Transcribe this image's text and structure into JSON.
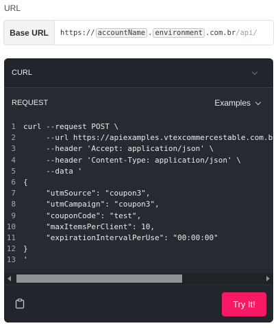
{
  "url_section": {
    "label": "URL",
    "base_url_label": "Base URL",
    "base_url": {
      "prefix": "https://",
      "account_var": "accountName",
      "dot1": ".",
      "environment_var": "environment",
      "suffix": ".com.br",
      "tail": "/api/"
    }
  },
  "curl_panel": {
    "title": "CURL",
    "request_title": "REQUEST",
    "examples_label": "Examples",
    "code_lines": [
      {
        "n": "1",
        "text": "curl --request POST \\"
      },
      {
        "n": "2",
        "text": "     --url https://apiexamples.vtexcommercestable.com.br/"
      },
      {
        "n": "3",
        "text": "     --header 'Accept: application/json' \\"
      },
      {
        "n": "4",
        "text": "     --header 'Content-Type: application/json' \\"
      },
      {
        "n": "5",
        "text": "     --data '"
      },
      {
        "n": "6",
        "text": "{"
      },
      {
        "n": "7",
        "text": "     \"utmSource\": \"coupon3\","
      },
      {
        "n": "8",
        "text": "     \"utmCampaign\": \"coupon3\","
      },
      {
        "n": "9",
        "text": "     \"couponCode\": \"test\","
      },
      {
        "n": "10",
        "text": "     \"maxItemsPerClient\": 10,"
      },
      {
        "n": "11",
        "text": "     \"expirationIntervalPerUse\": \"00:00:00\""
      },
      {
        "n": "12",
        "text": "}"
      },
      {
        "n": "13",
        "text": "'"
      }
    ],
    "try_button_label": "Try It!"
  },
  "icons": {
    "clipboard": "clipboard-icon",
    "curl_toggle": "chevron-down-icon",
    "examples_toggle": "chevron-down-icon"
  },
  "colors": {
    "accent": "#f71963",
    "panel_bg": "#252b30"
  }
}
